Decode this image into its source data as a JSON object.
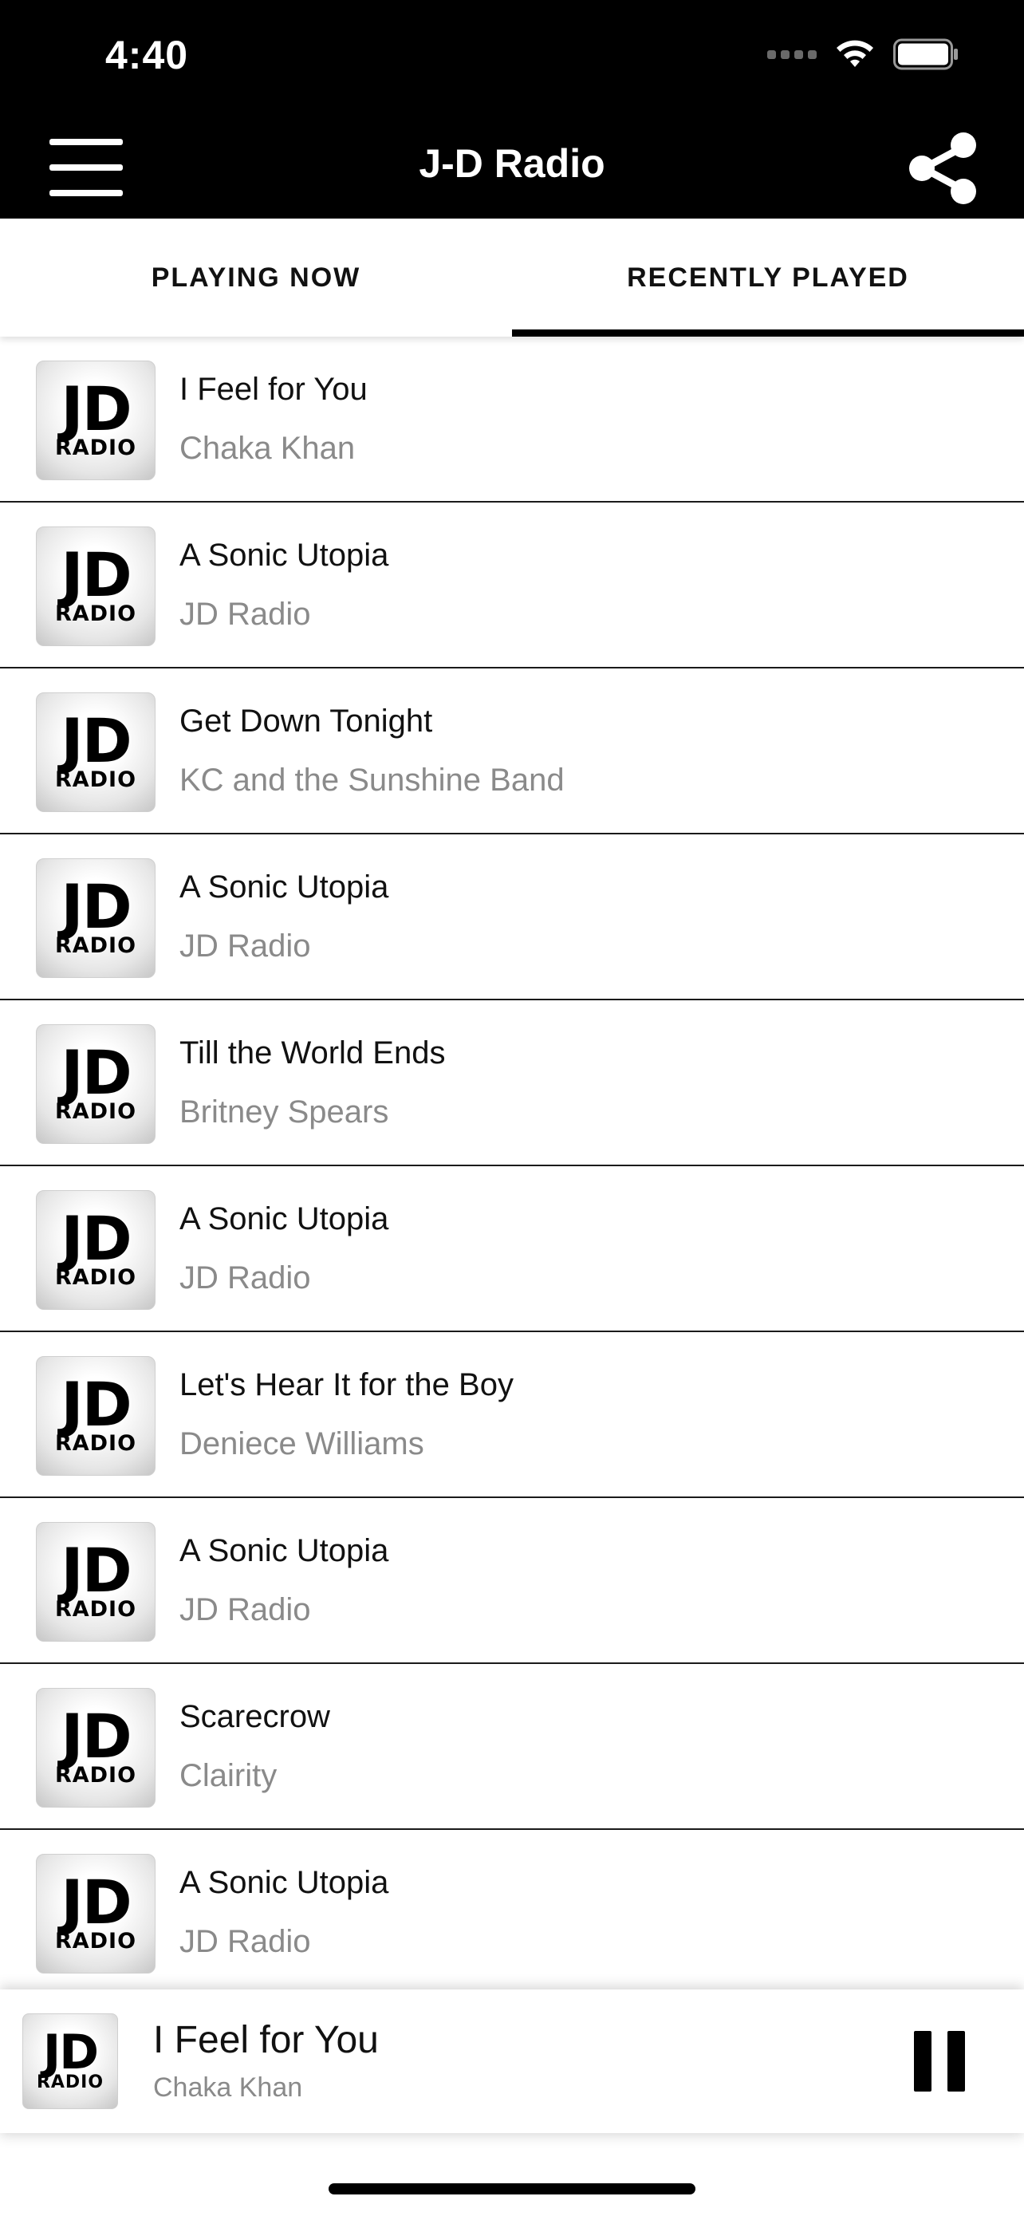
{
  "status_bar": {
    "time": "4:40"
  },
  "header": {
    "title": "J-D Radio",
    "menu_icon": "hamburger-menu-icon",
    "share_icon": "share-icon"
  },
  "tabs": [
    {
      "label": "PLAYING NOW",
      "active": false
    },
    {
      "label": "RECENTLY PLAYED",
      "active": true
    }
  ],
  "logo": {
    "big": "JD",
    "small": "RADIO"
  },
  "tracks": [
    {
      "title": "I Feel for You",
      "artist": "Chaka Khan"
    },
    {
      "title": "A Sonic Utopia",
      "artist": "JD Radio"
    },
    {
      "title": "Get Down Tonight",
      "artist": "KC and the Sunshine Band"
    },
    {
      "title": "A Sonic Utopia",
      "artist": "JD Radio"
    },
    {
      "title": "Till the World Ends",
      "artist": "Britney Spears"
    },
    {
      "title": "A Sonic Utopia",
      "artist": "JD Radio"
    },
    {
      "title": "Let's Hear It for the Boy",
      "artist": "Deniece Williams"
    },
    {
      "title": "A Sonic Utopia",
      "artist": "JD Radio"
    },
    {
      "title": "Scarecrow",
      "artist": "Clairity"
    },
    {
      "title": "A Sonic Utopia",
      "artist": "JD Radio"
    }
  ],
  "now_playing": {
    "title": "I Feel for You",
    "artist": "Chaka Khan",
    "control_icon": "pause-icon"
  },
  "colors": {
    "header_bg": "#000000",
    "artist_text": "#8a8a8a",
    "divider": "#1a1a1a"
  }
}
